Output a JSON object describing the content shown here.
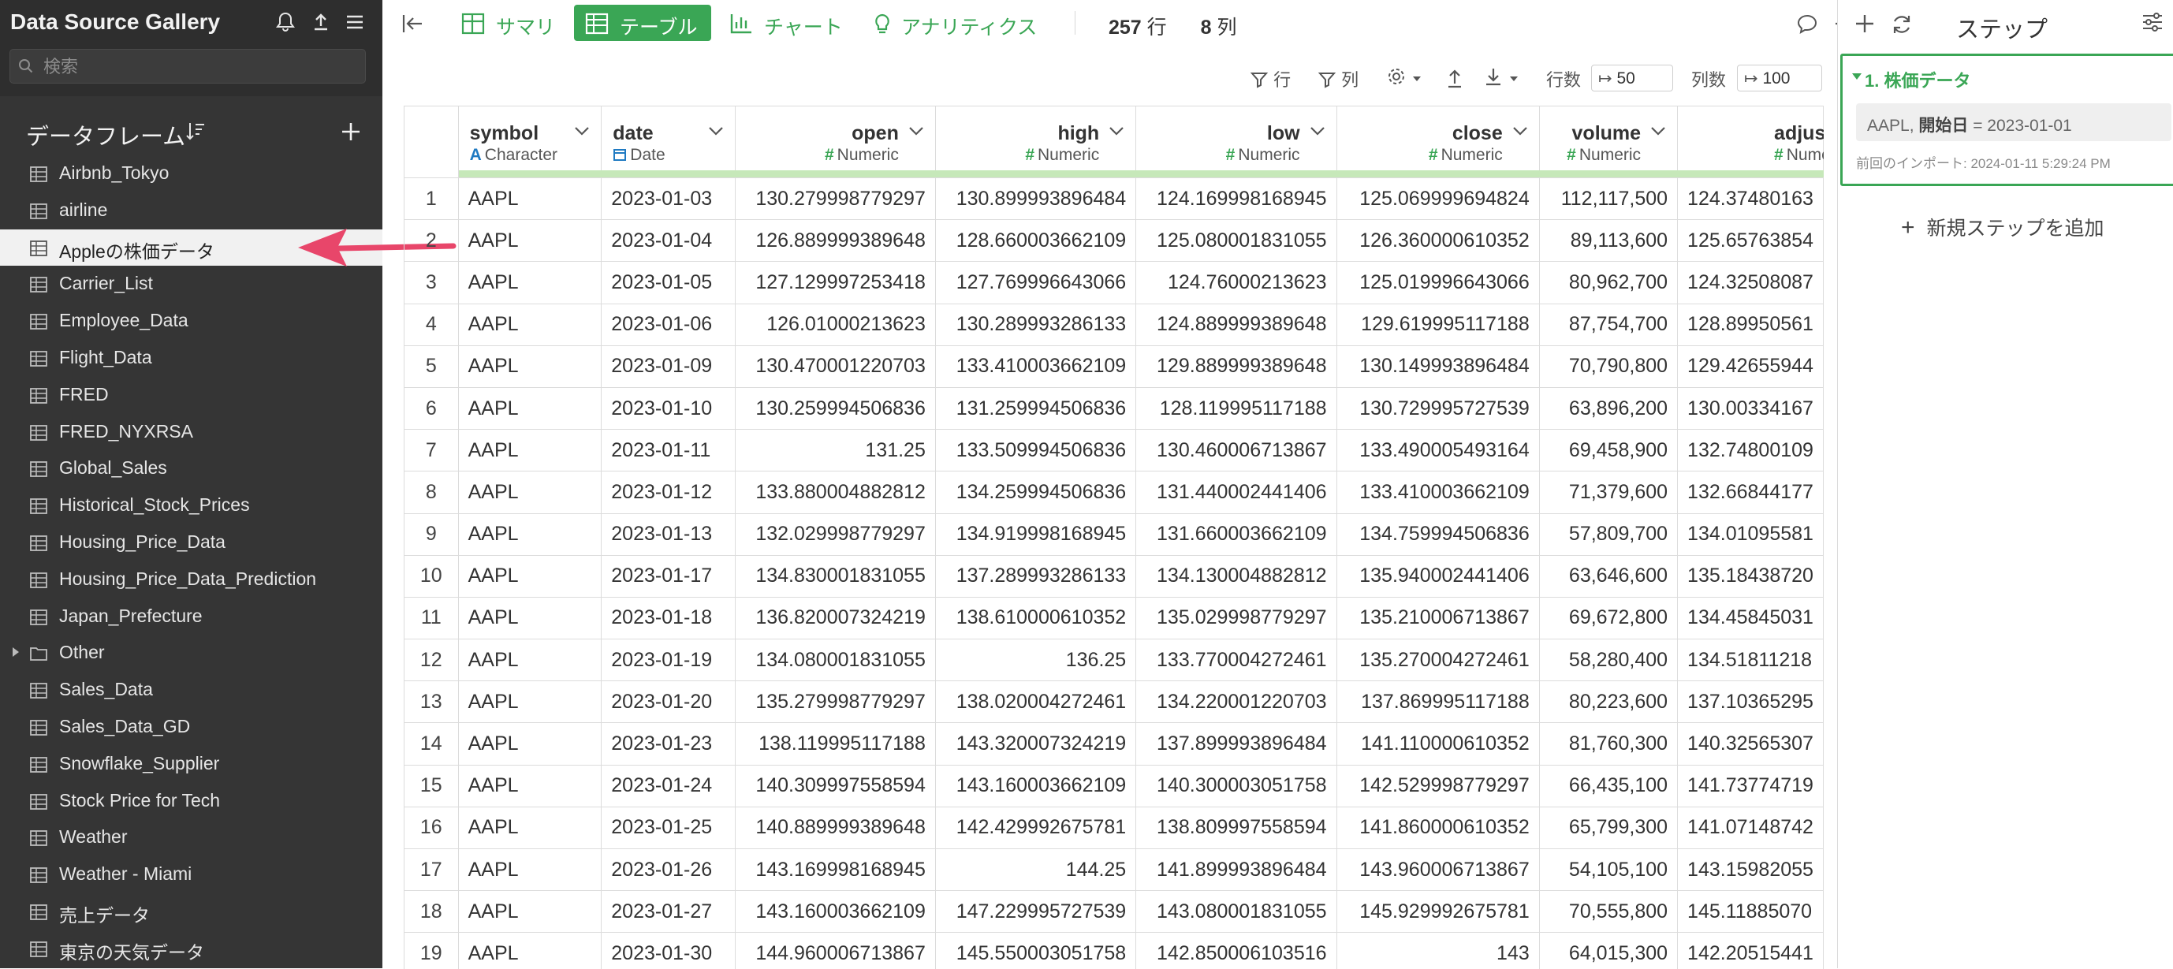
{
  "sidebar": {
    "title": "Data Source Gallery",
    "search_placeholder": "検索",
    "section_label": "データフレーム",
    "items": [
      {
        "label": "Airbnb_Tokyo",
        "type": "table"
      },
      {
        "label": "airline",
        "type": "table"
      },
      {
        "label": "Appleの株価データ",
        "type": "table",
        "selected": true
      },
      {
        "label": "Carrier_List",
        "type": "table"
      },
      {
        "label": "Employee_Data",
        "type": "table"
      },
      {
        "label": "Flight_Data",
        "type": "table"
      },
      {
        "label": "FRED",
        "type": "table"
      },
      {
        "label": "FRED_NYXRSA",
        "type": "table"
      },
      {
        "label": "Global_Sales",
        "type": "table"
      },
      {
        "label": "Historical_Stock_Prices",
        "type": "table"
      },
      {
        "label": "Housing_Price_Data",
        "type": "table"
      },
      {
        "label": "Housing_Price_Data_Prediction",
        "type": "table"
      },
      {
        "label": "Japan_Prefecture",
        "type": "table"
      },
      {
        "label": "Other",
        "type": "folder"
      },
      {
        "label": "Sales_Data",
        "type": "table"
      },
      {
        "label": "Sales_Data_GD",
        "type": "table"
      },
      {
        "label": "Snowflake_Supplier",
        "type": "table"
      },
      {
        "label": "Stock Price for Tech",
        "type": "table"
      },
      {
        "label": "Weather",
        "type": "table"
      },
      {
        "label": "Weather - Miami",
        "type": "table"
      },
      {
        "label": "売上データ",
        "type": "table"
      },
      {
        "label": "東京の天気データ",
        "type": "table"
      }
    ]
  },
  "toolbar": {
    "tabs": [
      {
        "label": "サマリ",
        "icon": "summary-icon"
      },
      {
        "label": "テーブル",
        "icon": "table-icon",
        "active": true
      },
      {
        "label": "チャート",
        "icon": "chart-icon"
      },
      {
        "label": "アナリティクス",
        "icon": "bulb-icon"
      }
    ],
    "row_count": "257",
    "row_unit": "行",
    "col_count": "8",
    "col_unit": "列"
  },
  "subbar": {
    "filter_rows": "行",
    "filter_cols": "列",
    "rows_label": "行数",
    "rows_value": "50",
    "cols_label": "列数",
    "cols_value": "100"
  },
  "table": {
    "columns": [
      {
        "name": "symbol",
        "type": "Character"
      },
      {
        "name": "date",
        "type": "Date"
      },
      {
        "name": "open",
        "type": "Numeric"
      },
      {
        "name": "high",
        "type": "Numeric"
      },
      {
        "name": "low",
        "type": "Numeric"
      },
      {
        "name": "close",
        "type": "Numeric"
      },
      {
        "name": "volume",
        "type": "Numeric"
      },
      {
        "name": "adjust",
        "type": "Nume"
      }
    ],
    "rows": [
      [
        "1",
        "AAPL",
        "2023-01-03",
        "130.279998779297",
        "130.899993896484",
        "124.169998168945",
        "125.069999694824",
        "112,117,500",
        "124.37480163"
      ],
      [
        "2",
        "AAPL",
        "2023-01-04",
        "126.889999389648",
        "128.660003662109",
        "125.080001831055",
        "126.360000610352",
        "89,113,600",
        "125.65763854"
      ],
      [
        "3",
        "AAPL",
        "2023-01-05",
        "127.129997253418",
        "127.769996643066",
        "124.76000213623",
        "125.019996643066",
        "80,962,700",
        "124.32508087"
      ],
      [
        "4",
        "AAPL",
        "2023-01-06",
        "126.01000213623",
        "130.289993286133",
        "124.889999389648",
        "129.619995117188",
        "87,754,700",
        "128.89950561"
      ],
      [
        "5",
        "AAPL",
        "2023-01-09",
        "130.470001220703",
        "133.410003662109",
        "129.889999389648",
        "130.149993896484",
        "70,790,800",
        "129.42655944"
      ],
      [
        "6",
        "AAPL",
        "2023-01-10",
        "130.259994506836",
        "131.259994506836",
        "128.119995117188",
        "130.729995727539",
        "63,896,200",
        "130.00334167"
      ],
      [
        "7",
        "AAPL",
        "2023-01-11",
        "131.25",
        "133.509994506836",
        "130.460006713867",
        "133.490005493164",
        "69,458,900",
        "132.74800109"
      ],
      [
        "8",
        "AAPL",
        "2023-01-12",
        "133.880004882812",
        "134.259994506836",
        "131.440002441406",
        "133.410003662109",
        "71,379,600",
        "132.66844177"
      ],
      [
        "9",
        "AAPL",
        "2023-01-13",
        "132.029998779297",
        "134.919998168945",
        "131.660003662109",
        "134.759994506836",
        "57,809,700",
        "134.01095581"
      ],
      [
        "10",
        "AAPL",
        "2023-01-17",
        "134.830001831055",
        "137.289993286133",
        "134.130004882812",
        "135.940002441406",
        "63,646,600",
        "135.18438720"
      ],
      [
        "11",
        "AAPL",
        "2023-01-18",
        "136.820007324219",
        "138.610000610352",
        "135.029998779297",
        "135.210006713867",
        "69,672,800",
        "134.45845031"
      ],
      [
        "12",
        "AAPL",
        "2023-01-19",
        "134.080001831055",
        "136.25",
        "133.770004272461",
        "135.270004272461",
        "58,280,400",
        "134.51811218"
      ],
      [
        "13",
        "AAPL",
        "2023-01-20",
        "135.279998779297",
        "138.020004272461",
        "134.220001220703",
        "137.869995117188",
        "80,223,600",
        "137.10365295"
      ],
      [
        "14",
        "AAPL",
        "2023-01-23",
        "138.119995117188",
        "143.320007324219",
        "137.899993896484",
        "141.110000610352",
        "81,760,300",
        "140.32565307"
      ],
      [
        "15",
        "AAPL",
        "2023-01-24",
        "140.309997558594",
        "143.160003662109",
        "140.300003051758",
        "142.529998779297",
        "66,435,100",
        "141.73774719"
      ],
      [
        "16",
        "AAPL",
        "2023-01-25",
        "140.889999389648",
        "142.429992675781",
        "138.809997558594",
        "141.860000610352",
        "65,799,300",
        "141.07148742"
      ],
      [
        "17",
        "AAPL",
        "2023-01-26",
        "143.169998168945",
        "144.25",
        "141.899993896484",
        "143.960006713867",
        "54,105,100",
        "143.15982055"
      ],
      [
        "18",
        "AAPL",
        "2023-01-27",
        "143.160003662109",
        "147.229995727539",
        "143.080001831055",
        "145.929992675781",
        "70,555,800",
        "145.11885070"
      ],
      [
        "19",
        "AAPL",
        "2023-01-30",
        "144.960006713867",
        "145.550003051758",
        "142.850006103516",
        "143",
        "64,015,300",
        "142.20515441"
      ]
    ]
  },
  "right_panel": {
    "title": "ステップ",
    "step_title": "1. 株価データ",
    "step_detail_symbol": "AAPL, ",
    "step_detail_key": "開始日",
    "step_detail_value": " = 2023-01-01",
    "step_import": "前回のインポート: 2024-01-11 5:29:24 PM",
    "add_step": "新規ステップを追加"
  },
  "colors": {
    "accent": "#3aa655",
    "sidebar_bg": "#2e2e2e",
    "arrow": "#e8466a"
  }
}
